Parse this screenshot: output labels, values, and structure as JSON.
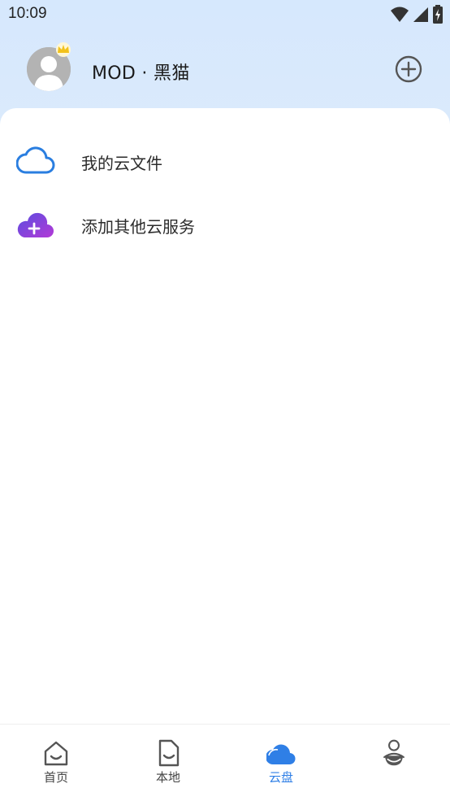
{
  "status_bar": {
    "time": "10:09",
    "icons": [
      "wifi-icon",
      "signal-icon",
      "battery-charging-icon"
    ]
  },
  "header": {
    "user_name": "MOD · 黑猫",
    "avatar_icon": "default-user-avatar-icon",
    "badge_icon": "crown-icon",
    "add_icon": "circle-plus-icon"
  },
  "list": {
    "items": [
      {
        "label": "我的云文件",
        "icon": "cloud-outline-icon"
      },
      {
        "label": "添加其他云服务",
        "icon": "cloud-add-icon"
      }
    ]
  },
  "bottom_nav": {
    "items": [
      {
        "label": "首页",
        "icon": "home-icon",
        "active": false
      },
      {
        "label": "本地",
        "icon": "local-file-icon",
        "active": false
      },
      {
        "label": "云盘",
        "icon": "cloud-filled-icon",
        "active": true
      },
      {
        "label": "",
        "icon": "profile-icon",
        "active": false
      }
    ],
    "active_color": "#2f7fe6"
  },
  "colors": {
    "header_bg": "#d6e8fd",
    "accent": "#2f7fe6",
    "cloud_add_gradient": [
      "#5b4de0",
      "#b23ad6"
    ]
  }
}
